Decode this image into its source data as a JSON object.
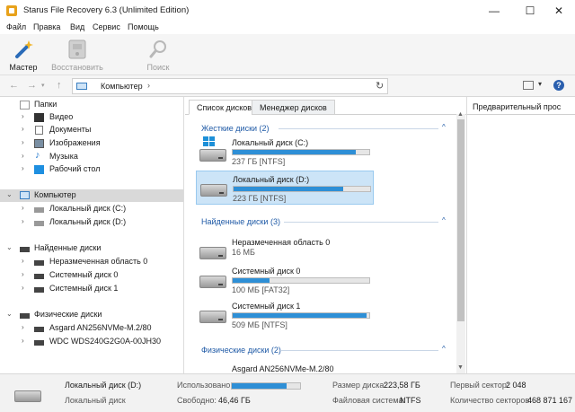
{
  "window": {
    "title": "Starus File Recovery 6.3 (Unlimited Edition)",
    "minimize": "—",
    "maximize": "☐",
    "close": "✕"
  },
  "menu": [
    "Файл",
    "Правка",
    "Вид",
    "Сервис",
    "Помощь"
  ],
  "ribbon": {
    "master": "Мастер",
    "restore": "Восстановить",
    "search": "Поиск"
  },
  "address": {
    "path": "Компьютер",
    "chevron": "›"
  },
  "tree": {
    "folders_header": "Папки",
    "folders": [
      "Видео",
      "Документы",
      "Изображения",
      "Музыка",
      "Рабочий стол"
    ],
    "computer_header": "Компьютер",
    "computer_items": [
      "Локальный диск (C:)",
      "Локальный диск (D:)"
    ],
    "found_header": "Найденные диски",
    "found_items": [
      "Неразмеченная область 0",
      "Системный диск 0",
      "Системный диск 1"
    ],
    "physical_header": "Физические диски",
    "physical_items": [
      "Asgard AN256NVMe-M.2/80",
      "WDC WDS240G2G0A-00JH30"
    ]
  },
  "tabs": {
    "disk_list": "Список дисков",
    "disk_manager": "Менеджер дисков",
    "preview": "Предварительный прос"
  },
  "groups": {
    "hard": "Жесткие диски (2)",
    "found": "Найденные диски (3)",
    "physical": "Физические диски (2)"
  },
  "drives": [
    {
      "name": "Локальный диск (C:)",
      "info": "237 ГБ [NTFS]",
      "used_fraction": 0.9,
      "selected": false,
      "windows": true
    },
    {
      "name": "Локальный диск (D:)",
      "info": "223 ГБ [NTFS]",
      "used_fraction": 0.8,
      "selected": true,
      "windows": false
    }
  ],
  "found_drives": [
    {
      "name": "Неразмеченная область 0",
      "info": "16 МБ"
    },
    {
      "name": "Системный диск 0",
      "info": "100 МБ [FAT32]",
      "used_fraction": 0.27
    },
    {
      "name": "Системный диск 1",
      "info": "509 МБ [NTFS]",
      "used_fraction": 0.98
    }
  ],
  "physical_drives": [
    {
      "name": "Asgard AN256NVMe-M.2/80"
    }
  ],
  "status": {
    "disk_name": "Локальный диск (D:)",
    "disk_type": "Локальный диск",
    "used_label": "Использовано:",
    "used_fraction": 0.8,
    "free_label": "Свободно:",
    "free_value": "46,46 ГБ",
    "size_label": "Размер диска:",
    "size_value": "223,58 ГБ",
    "fs_label": "Файловая система:",
    "fs_value": "NTFS",
    "first_sector_label": "Первый сектор:",
    "first_sector_value": "2 048",
    "sector_count_label": "Количество секторов:",
    "sector_count_value": "468 871 167"
  },
  "colors": {
    "accent": "#2e8fd6",
    "group_text": "#1f5aa6",
    "selection": "#cce4f7"
  }
}
